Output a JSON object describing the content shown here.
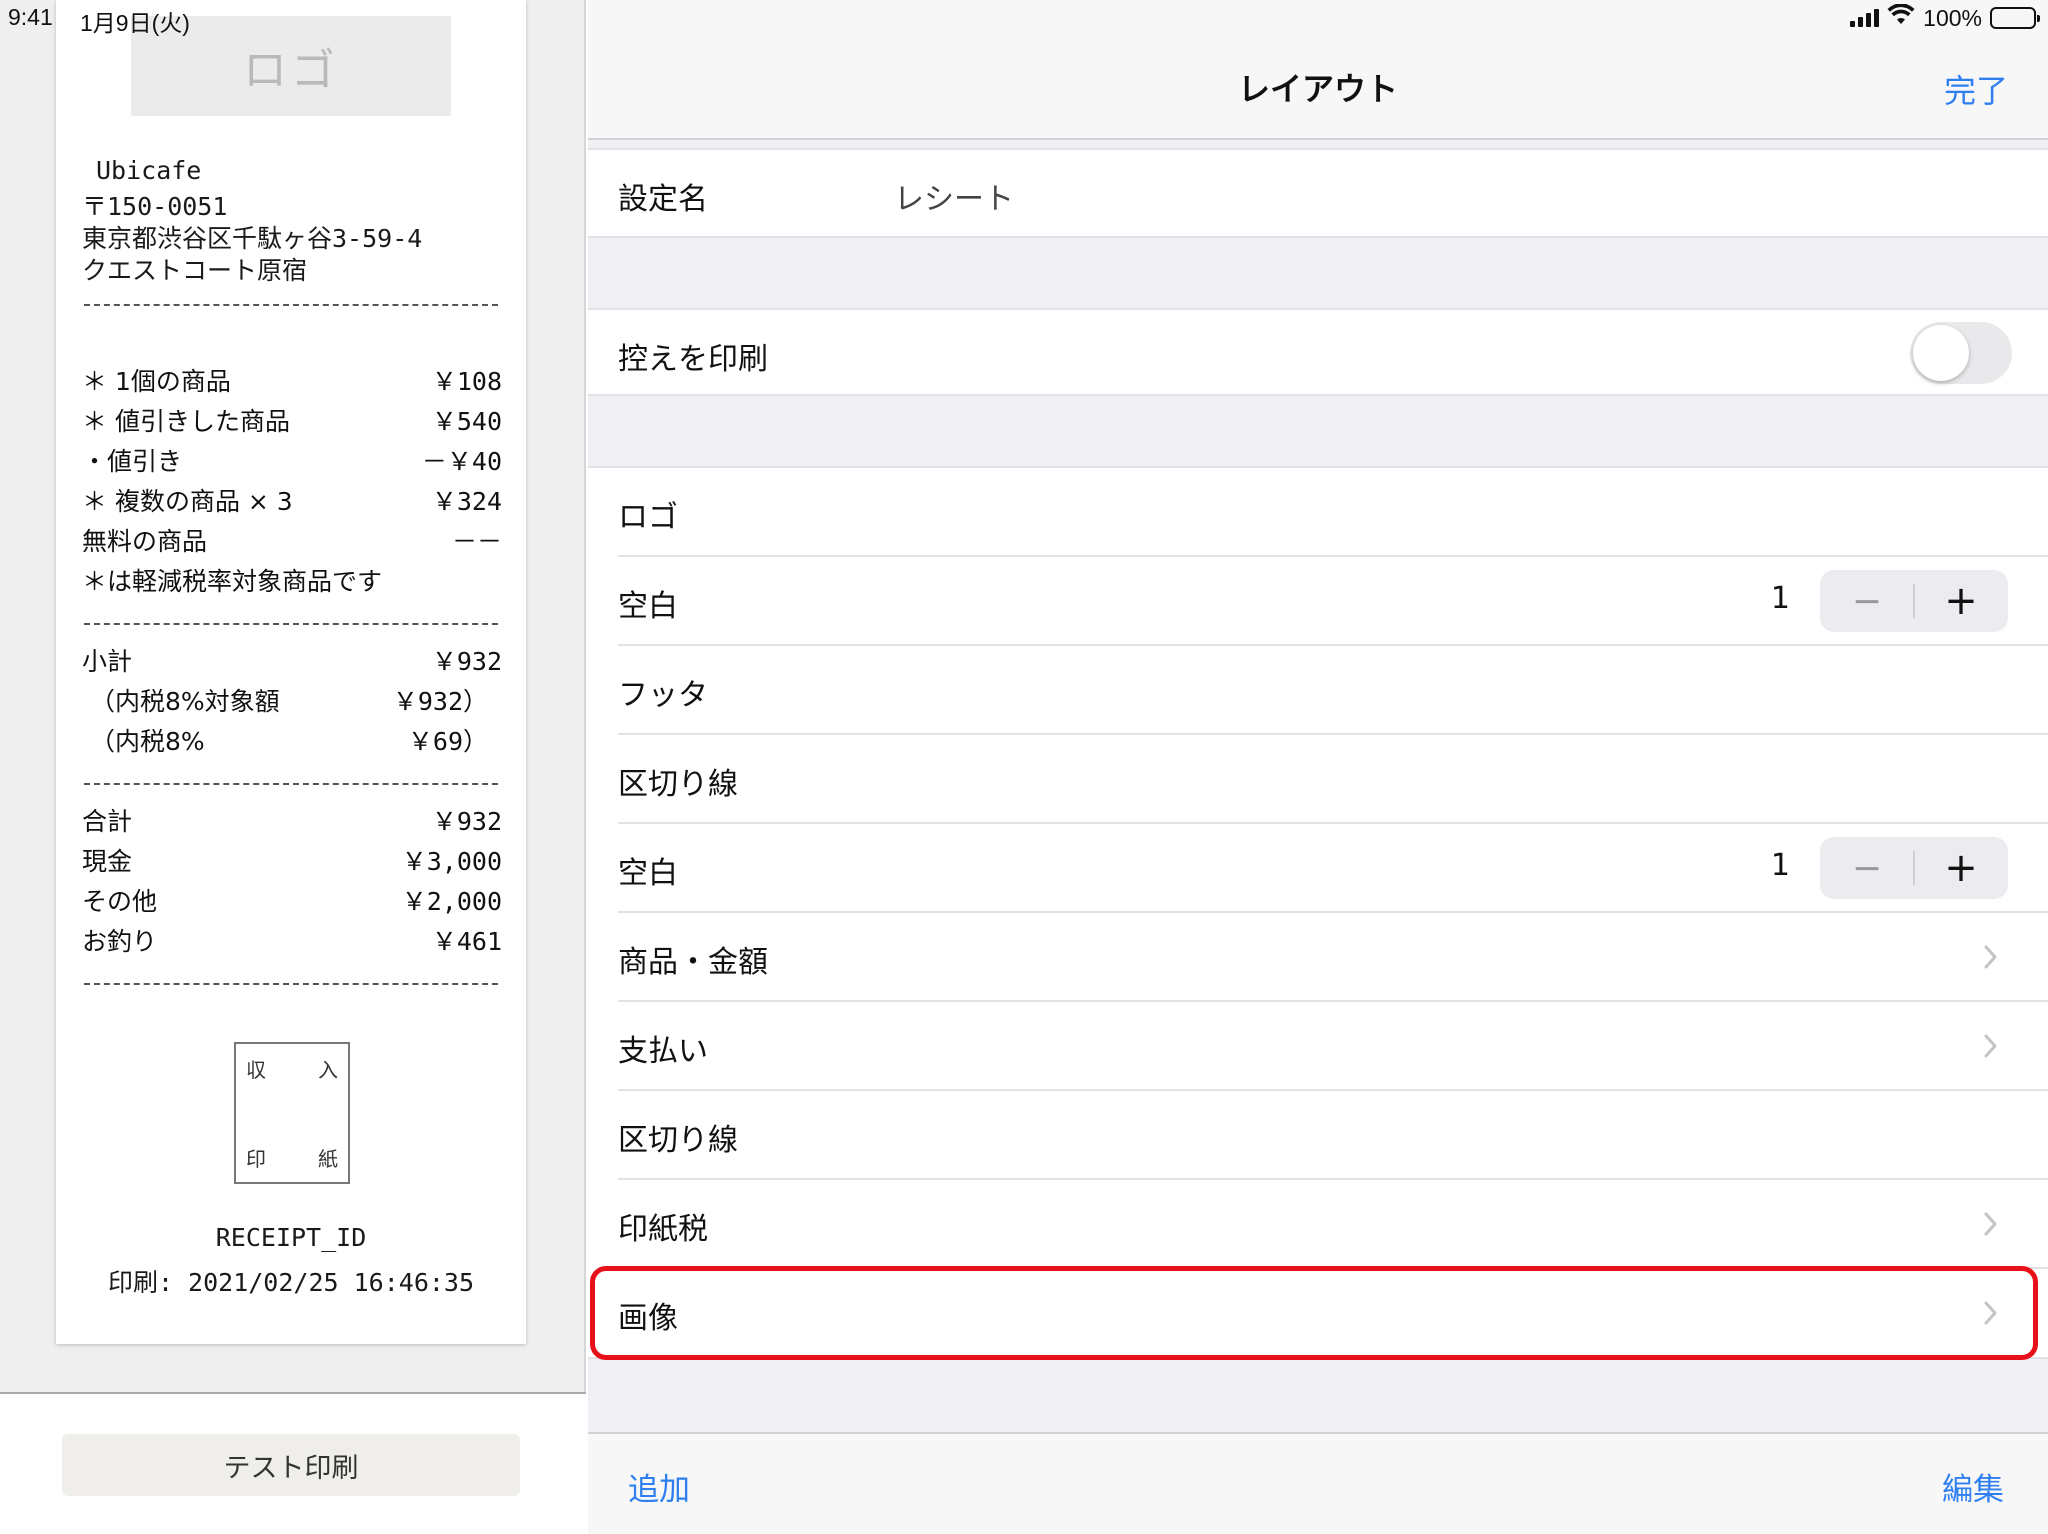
{
  "status_bar": {
    "time": "9:41",
    "date": "1月9日(火)",
    "battery": "100%",
    "battery_level": 1.0
  },
  "receipt": {
    "logo_label": "ロゴ",
    "store_name": "Ubicafe",
    "zip": "〒150-0051",
    "address1": "東京都渋谷区千駄ヶ谷3-59-4",
    "address2": "クエストコート原宿",
    "items": [
      {
        "label": "＊ 1個の商品",
        "value": "￥108"
      },
      {
        "label": "＊ 値引きした商品",
        "value": "￥540"
      },
      {
        "label": "・値引き",
        "value": "－￥40"
      },
      {
        "label": "＊ 複数の商品 × 3",
        "value": "￥324"
      },
      {
        "label": "無料の商品",
        "value": "－－"
      },
      {
        "label": "＊は軽減税率対象商品です",
        "value": ""
      }
    ],
    "subtotals": [
      {
        "label": "小計",
        "value": "￥932"
      },
      {
        "label": "（内税8%対象額",
        "value": "￥932）"
      },
      {
        "label": "（内税8%",
        "value": "￥69）"
      }
    ],
    "totals": [
      {
        "label": "合計",
        "value": "￥932"
      },
      {
        "label": "現金",
        "value": "￥3,000"
      },
      {
        "label": "その他",
        "value": "￥2,000"
      },
      {
        "label": "お釣り",
        "value": "￥461"
      }
    ],
    "stamp": {
      "tl": "収",
      "tr": "入",
      "bl": "印",
      "br": "紙"
    },
    "receipt_id": "RECEIPT_ID",
    "printed_at": "印刷: 2021/02/25 16:46:35"
  },
  "test_print_label": "テスト印刷",
  "nav": {
    "title": "レイアウト",
    "done_label": "完了"
  },
  "settings": {
    "name_label": "設定名",
    "name_value": "レシート",
    "print_copy_label": "控えを印刷",
    "print_copy_on": false
  },
  "layout_rows": [
    {
      "label": "ロゴ"
    },
    {
      "label": "空白",
      "value": "1",
      "minus": "−",
      "plus": "+"
    },
    {
      "label": "フッタ"
    },
    {
      "label": "区切り線"
    },
    {
      "label": "空白",
      "value": "1",
      "minus": "−",
      "plus": "+"
    },
    {
      "label": "商品・金額"
    },
    {
      "label": "支払い"
    },
    {
      "label": "区切り線"
    },
    {
      "label": "印紙税"
    },
    {
      "label": "画像"
    }
  ],
  "toolbar": {
    "add_label": "追加",
    "edit_label": "編集"
  },
  "colors": {
    "accent": "#2f7ff0",
    "highlight": "#e8111b"
  }
}
